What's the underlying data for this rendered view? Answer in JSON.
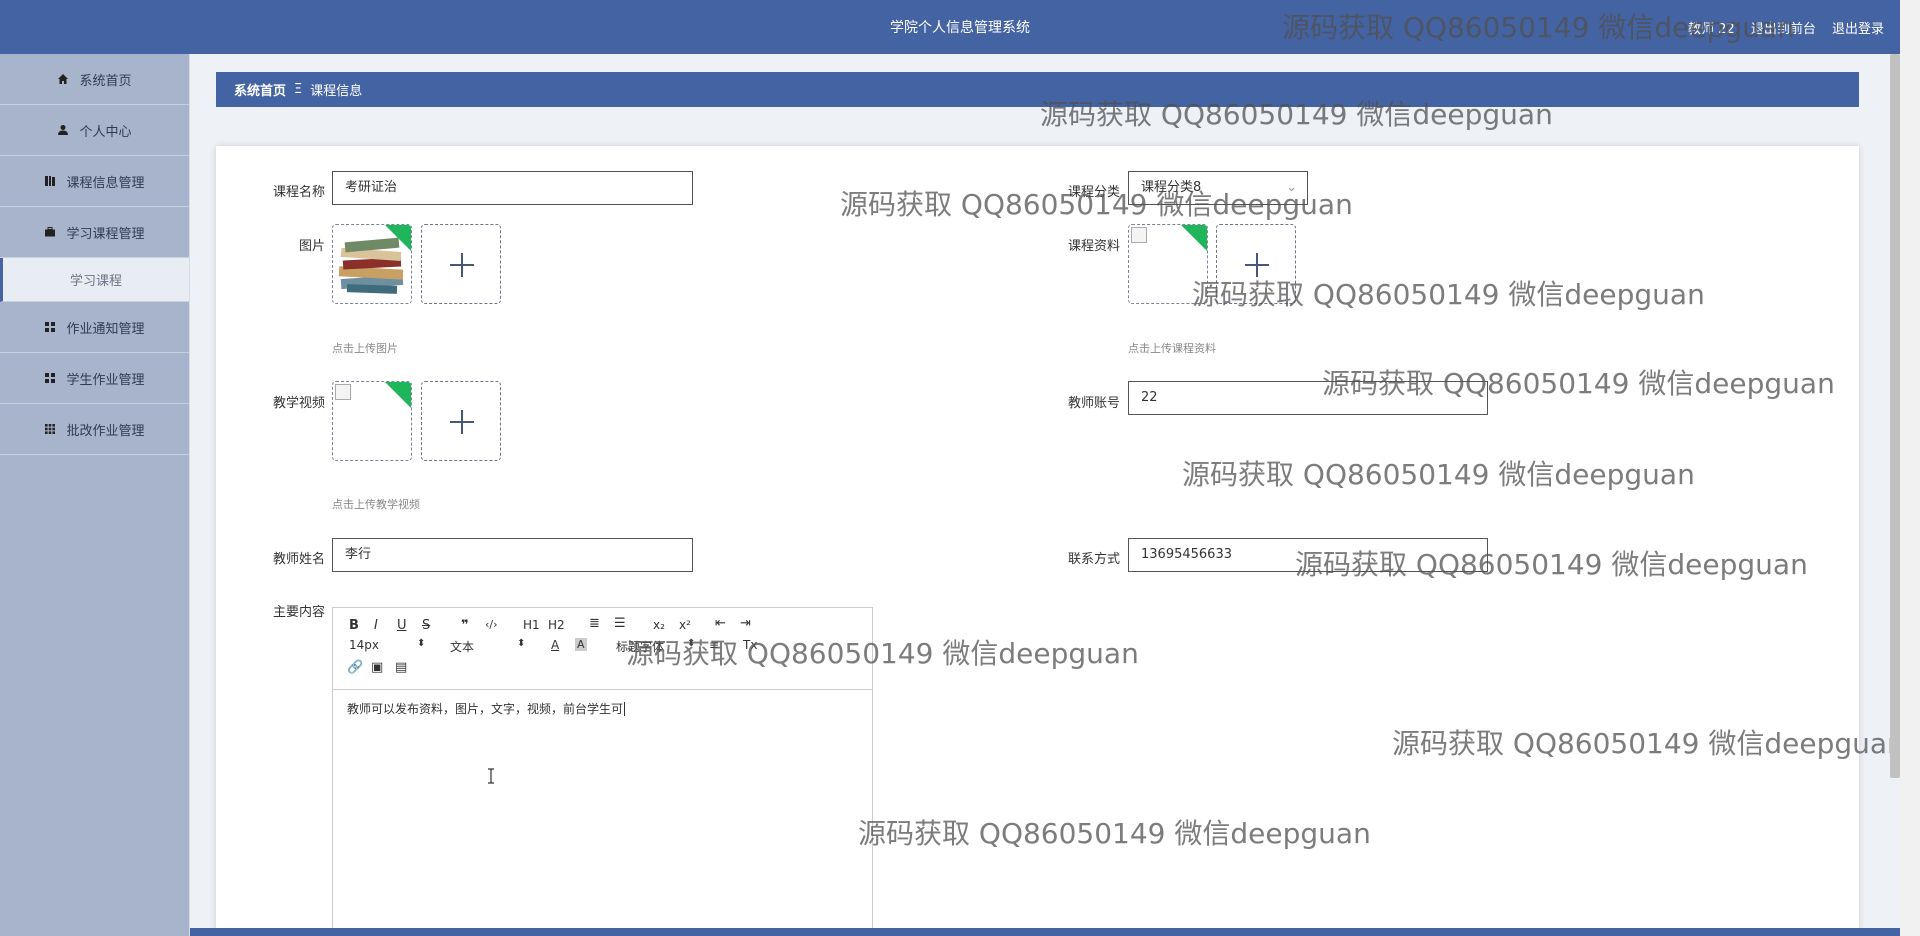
{
  "header": {
    "title": "学院个人信息管理系统",
    "user_label": "教师 22",
    "back_label": "退出到前台",
    "logout_label": "退出登录"
  },
  "sidebar": {
    "items": [
      {
        "label": "系统首页",
        "icon": "home-icon"
      },
      {
        "label": "个人中心",
        "icon": "user-icon"
      },
      {
        "label": "课程信息管理",
        "icon": "book-icon"
      },
      {
        "label": "学习课程管理",
        "icon": "briefcase-icon"
      },
      {
        "label": "作业通知管理",
        "icon": "grid-icon"
      },
      {
        "label": "学生作业管理",
        "icon": "grid-icon"
      },
      {
        "label": "批改作业管理",
        "icon": "grid-icon"
      }
    ],
    "sub_item": "学习课程"
  },
  "breadcrumb": {
    "home": "系统首页",
    "separator": "Ξ",
    "current": "课程信息"
  },
  "form": {
    "course_name_label": "课程名称",
    "course_name_value": "考研证治",
    "category_label": "课程分类",
    "category_value": "课程分类8",
    "image_label": "图片",
    "image_hint": "点击上传图片",
    "material_label": "课程资料",
    "material_hint": "点击上传课程资料",
    "video_label": "教学视频",
    "video_hint": "点击上传教学视频",
    "teacher_account_label": "教师账号",
    "teacher_account_value": "22",
    "teacher_name_label": "教师姓名",
    "teacher_name_value": "李行",
    "contact_label": "联系方式",
    "contact_value": "13695456633",
    "content_label": "主要内容"
  },
  "editor": {
    "font_size": "14px",
    "text_style": "文本",
    "heading": "标题字体",
    "h1": "H1",
    "h2": "H2",
    "quote": "❞",
    "code": "‹/›",
    "sub": "x₂",
    "sup": "x²",
    "content": "教师可以发布资料，图片，文字，视频，前台学生可"
  },
  "watermark": "源码获取 QQ86050149 微信deepguan",
  "colors": {
    "primary": "#4463a3",
    "sidebar": "#a8b4cc",
    "corner_badge": "#1fb55a"
  }
}
